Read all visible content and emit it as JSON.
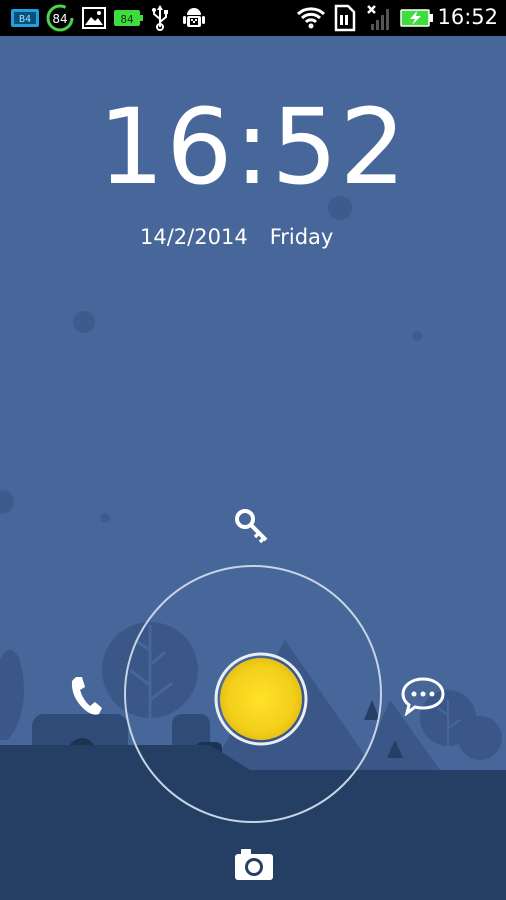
{
  "status_bar": {
    "time": "16:52",
    "notification_icons": [
      "sms-badge-icon",
      "battery-84-icon",
      "gallery-icon",
      "battery-widget-icon",
      "usb-icon",
      "android-debug-icon"
    ],
    "badge_84": "84",
    "widget_84": "84",
    "system_icons": [
      "wifi-icon",
      "sim-icon",
      "no-signal-icon",
      "battery-charging-icon"
    ]
  },
  "lockscreen": {
    "time": "16:52",
    "date": "14/2/2014",
    "day": "Friday"
  },
  "unlock_ring": {
    "targets": [
      "unlock-key-icon",
      "phone-icon",
      "messages-icon",
      "camera-icon"
    ]
  },
  "colors": {
    "sky": "#47679a",
    "hills": "#3a5788",
    "ground": "#243f63",
    "orb": "#ffd91a"
  }
}
